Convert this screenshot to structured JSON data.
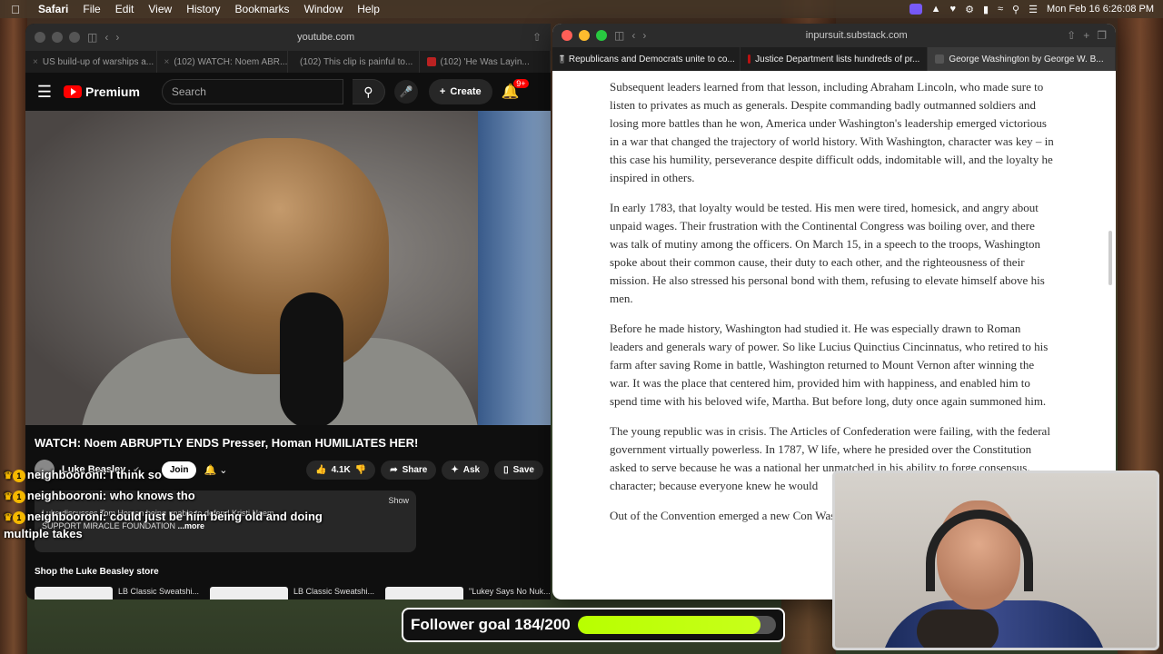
{
  "menubar": {
    "app": "Safari",
    "items": [
      "File",
      "Edit",
      "View",
      "History",
      "Bookmarks",
      "Window",
      "Help"
    ],
    "clock": "Mon Feb 16  6:26:08 PM"
  },
  "left_window": {
    "url": "youtube.com",
    "tabs": [
      {
        "label": "US build-up of warships a..."
      },
      {
        "label": "(102) WATCH: Noem ABR..."
      },
      {
        "label": "(102) This clip is painful to..."
      },
      {
        "label": "(102) 'He Was Layin..."
      }
    ],
    "youtube": {
      "logo": "Premium",
      "search_placeholder": "Search",
      "create_label": "Create",
      "notifications_badge": "9+",
      "video_title": "WATCH: Noem ABRUPTLY ENDS Presser, Homan HUMILIATES HER!",
      "channel": "Luke Beasley",
      "join_label": "Join",
      "likes": "4.1K",
      "share_label": "Share",
      "ask_label": "Ask",
      "save_label": "Save",
      "desc_line1": "Show",
      "desc_line2": "Luke discusses Tom Homan being unable to defend Kristi Noem.",
      "desc_line3": "SUPPORT MIRACLE FOUNDATION",
      "desc_more": "...more",
      "store_title": "Shop the Luke Beasley store",
      "products": [
        {
          "name": "LB Classic Sweatshi..."
        },
        {
          "name": "LB Classic Sweatshi..."
        },
        {
          "name": "\"Lukey Says No Nuk..."
        }
      ]
    }
  },
  "chat": [
    {
      "user": "neighbooroni:",
      "text": " I think so"
    },
    {
      "user": "neighbooroni:",
      "text": " who knows tho"
    },
    {
      "user": "neighbooroni:",
      "text": " could just be him being old and doing multiple takes"
    }
  ],
  "right_window": {
    "url": "inpursuit.substack.com",
    "tabs": [
      {
        "label": "Republicans and Democrats unite to co..."
      },
      {
        "label": "Justice Department lists hundreds of pr..."
      },
      {
        "label": "George Washington by George W. B..."
      }
    ],
    "article": {
      "p1": "Subsequent leaders learned from that lesson, including Abraham Lincoln, who made sure to listen to privates as much as generals. Despite commanding badly outmanned soldiers and losing more battles than he won, America under Washington's leadership emerged victorious in a war that changed the trajectory of world history. With Washington, character was key – in this case his humility, perseverance despite difficult odds, indomitable will, and the loyalty he inspired in others.",
      "p2": "In early 1783, that loyalty would be tested. His men were tired, homesick, and angry about unpaid wages. Their frustration with the Continental Congress was boiling over, and there was talk of mutiny among the officers. On March 15, in a speech to the troops, Washington spoke about their common cause, their duty to each other, and the righteousness of their mission. He also stressed his personal bond with them, refusing to elevate himself above his men.",
      "p3": "Before he made history, Washington had studied it. He was especially drawn to Roman leaders and generals wary of power. So like Lucius Quinctius Cincinnatus, who retired to his farm after saving Rome in battle, Washington returned to Mount Vernon after winning the war. It was the place that centered him, provided him with happiness, and enabled him to spend time with his beloved wife, Martha. But before long, duty once again summoned him.",
      "p4": "The young republic was in crisis. The Articles of Confederation were failing, with the federal government virtually powerless. In 1787, W life, where he presided over the Constitution asked to serve because he was a national her unmatched in his ability to forge consensus. character; because everyone knew he would",
      "p5": "Out of the Convention emerged a new Con Washington was the obvious choice and tw"
    }
  },
  "follower_goal": {
    "label": "Follower goal 184/200",
    "progress": 0.92
  }
}
